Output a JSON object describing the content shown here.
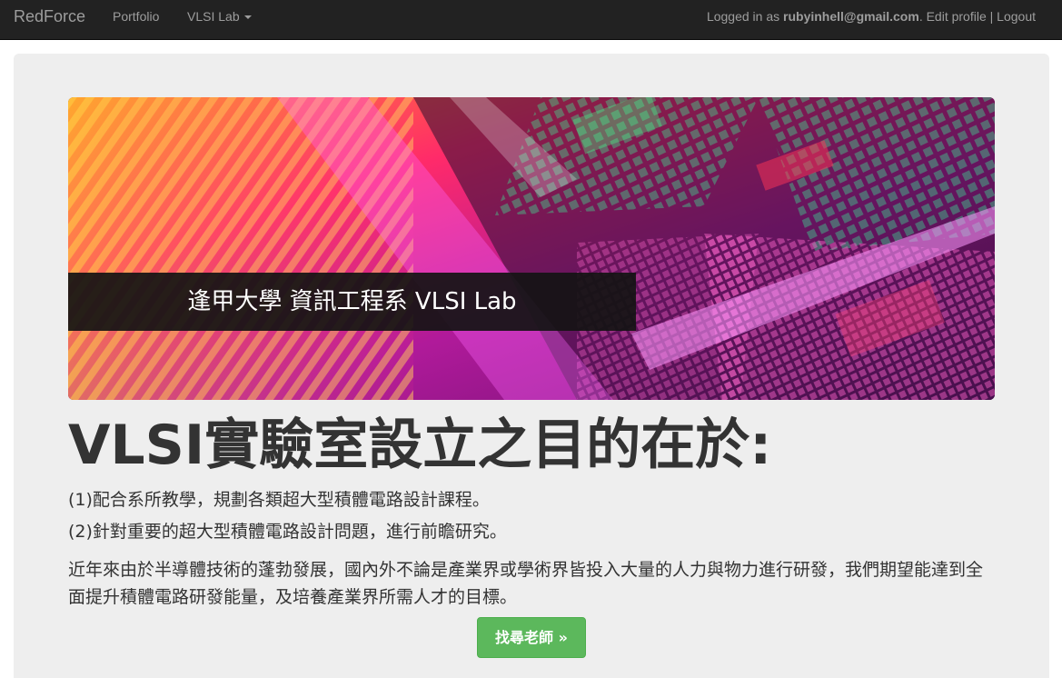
{
  "navbar": {
    "brand": "RedForce",
    "portfolio": "Portfolio",
    "vlsi_lab": "VLSI Lab",
    "logged_in_prefix": "Logged in as ",
    "user_email": "rubyinhell@gmail.com",
    "separator_dot": ".",
    "edit_profile": "Edit profile",
    "pipe": "|",
    "logout": "Logout"
  },
  "banner": {
    "caption": "逢甲大學 資訊工程系 VLSI Lab"
  },
  "main": {
    "headline": "VLSI實驗室設立之目的在於:",
    "paragraph1": "(1)配合系所教學，規劃各類超大型積體電路設計課程。",
    "paragraph2": "(2)針對重要的超大型積體電路設計問題，進行前瞻研究。",
    "paragraph3": "近年來由於半導體技術的蓬勃發展，國內外不論是產業界或學術界皆投入大量的人力與物力進行研發，我們期望能達到全面提升積體電路研發能量，及培養產業界所需人才的目標。",
    "button_label": "找尋老師 »"
  },
  "colors": {
    "navbar_bg": "#222222",
    "jumbotron_bg": "#eeeeee",
    "button_success": "#5cb85c"
  }
}
